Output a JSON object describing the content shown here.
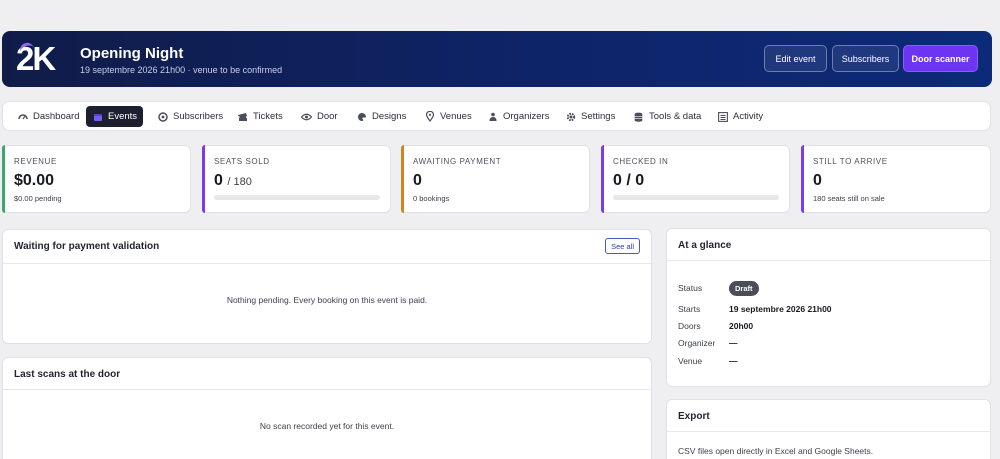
{
  "header": {
    "logo_text": "2K",
    "title": "Opening Night",
    "subtitle": "19 septembre 2026 21h00 · venue to be confirmed",
    "buttons": {
      "edit": "Edit event",
      "subscribers": "Subscribers",
      "door_scanner": "Door scanner"
    }
  },
  "nav": {
    "items": [
      {
        "label": "Dashboard",
        "icon": "dashboard-icon"
      },
      {
        "label": "Events",
        "icon": "calendar-icon",
        "active": true
      },
      {
        "label": "Subscribers",
        "icon": "subscribers-icon"
      },
      {
        "label": "Tickets",
        "icon": "ticket-icon"
      },
      {
        "label": "Door",
        "icon": "eye-icon"
      },
      {
        "label": "Designs",
        "icon": "palette-icon"
      },
      {
        "label": "Venues",
        "icon": "pin-icon"
      },
      {
        "label": "Organizers",
        "icon": "organizers-icon"
      },
      {
        "label": "Settings",
        "icon": "gear-icon"
      },
      {
        "label": "Tools & data",
        "icon": "database-icon"
      },
      {
        "label": "Activity",
        "icon": "list-icon"
      }
    ]
  },
  "stats": {
    "revenue": {
      "label": "REVENUE",
      "value": "$0.00",
      "note": "$0.00 pending",
      "color": "#3aa76d"
    },
    "seats_sold": {
      "label": "SEATS SOLD",
      "value": "0",
      "suffix": "/ 180",
      "progress": 0,
      "color": "#7c3aed"
    },
    "awaiting_payment": {
      "label": "AWAITING PAYMENT",
      "value": "0",
      "note": "0 bookings",
      "color": "#c98a1b"
    },
    "checked_in": {
      "label": "CHECKED IN",
      "value": "0 / 0",
      "progress": 0,
      "color": "#7c3aed"
    },
    "still_to_arrive": {
      "label": "STILL TO ARRIVE",
      "value": "0",
      "note": "180 seats still on sale",
      "color": "#7c3aed"
    }
  },
  "waiting": {
    "title": "Waiting for payment validation",
    "see_all": "See all",
    "empty": "Nothing pending. Every booking on this event is paid."
  },
  "scans": {
    "title": "Last scans at the door",
    "empty": "No scan recorded yet for this event."
  },
  "glance": {
    "title": "At a glance",
    "status_label": "Status",
    "status_value": "Draft",
    "starts_label": "Starts",
    "starts_value": "19 septembre 2026 21h00",
    "doors_label": "Doors",
    "doors_value": "20h00",
    "organizer_label": "Organizer",
    "organizer_value": "—",
    "venue_label": "Venue",
    "venue_value": "—"
  },
  "export": {
    "title": "Export",
    "note": "CSV files open directly in Excel and Google Sheets."
  },
  "colors": {
    "accent": "#6d35f2",
    "banner": "#0e2469"
  }
}
